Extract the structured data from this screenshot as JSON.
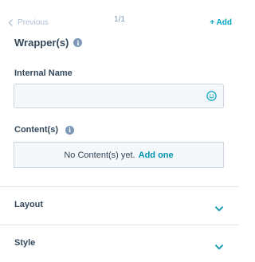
{
  "nav": {
    "previous_label": "Previous",
    "pager_text": "1/1",
    "add_label": "+ Add"
  },
  "section": {
    "title": "Wrapper(s)"
  },
  "fields": {
    "internal_name": {
      "label": "Internal Name",
      "value": "",
      "placeholder": ""
    },
    "contents": {
      "label": "Content(s)",
      "empty_text": "No Content(s) yet.",
      "add_label": "Add one"
    }
  },
  "accordions": [
    {
      "label": "Layout",
      "expanded": false
    },
    {
      "label": "Style",
      "expanded": false
    }
  ],
  "icons": {
    "previous": "chevron-left-icon",
    "info": "info-icon",
    "emoji": "smiley-icon",
    "accordion": "chevron-down-icon"
  },
  "colors": {
    "accent": "#00a4bd",
    "link": "#0091ae",
    "text": "#33475b",
    "muted": "#7c98b6",
    "disabled": "#b0c1d4",
    "input_bg": "#f5f8fa",
    "border": "#cbd6e2"
  }
}
